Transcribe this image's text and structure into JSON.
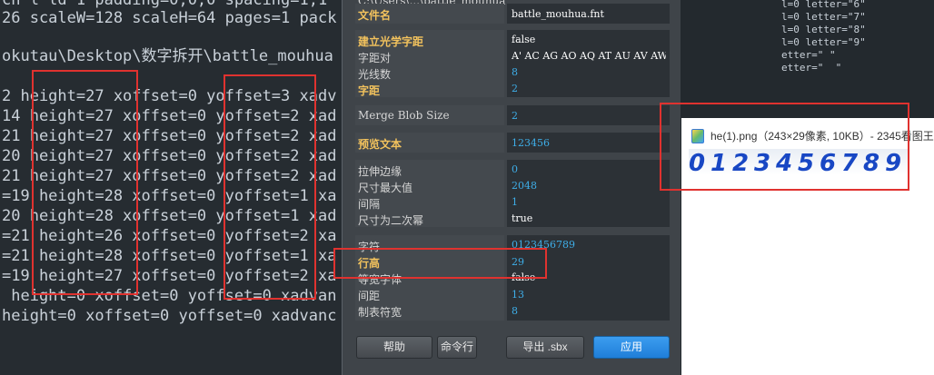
{
  "editor": {
    "lines": [
      "ch l ld 1 padding=0,0,0 spacing=1,1",
      "26 scaleW=128 scaleH=64 pages=1 pack",
      "",
      "okutau\\Desktop\\数字拆开\\battle_mouhua",
      "",
      "2 height=27 xoffset=0 yoffset=3 xadv",
      "14 height=27 xoffset=0 yoffset=2 xad",
      "21 height=27 xoffset=0 yoffset=2 xad",
      "20 height=27 xoffset=0 yoffset=2 xad",
      "21 height=27 xoffset=0 yoffset=2 xad",
      "=19 height=28 xoffset=0 yoffset=1 xa",
      "20 height=28 xoffset=0 yoffset=1 xad",
      "=21 height=26 xoffset=0 yoffset=2 xa",
      "=21 height=28 xoffset=0 yoffset=1 xa",
      "=19 height=27 xoffset=0 yoffset=2 xa",
      " height=0 xoffset=0 yoffset=0 xadvan",
      "height=0 xoffset=0 yoffset=0 xadvanc"
    ]
  },
  "right_editor": {
    "lines": [
      "l=0 letter=\"6\"",
      "l=0 letter=\"7\"",
      "l=0 letter=\"8\"",
      "l=0 letter=\"9\"",
      "etter=\" \"",
      "etter=\"  \""
    ]
  },
  "dialog": {
    "top_label": "C:\\Users\\...\\battle_mouhua",
    "file_name_label": "文件名",
    "file_name_value": "battle_mouhua.fnt",
    "build_label": "建立光学字距",
    "build_value": "false",
    "pair_label": "字距对",
    "pair_value": "A' AC AG AO AQ AT AU AV AW",
    "ray_label": "光线数",
    "ray_value": "8",
    "spacing_label": "字距",
    "spacing_value": "2",
    "merge_label": "Merge Blob Size",
    "merge_value": "2",
    "preview_label": "预览文本",
    "preview_value": "123456",
    "stretch_label": "拉伸边缘",
    "stretch_value": "0",
    "maxsize_label": "尺寸最大值",
    "maxsize_value": "2048",
    "gap_label": "间隔",
    "gap_value": "1",
    "pow2_label": "尺寸为二次幂",
    "pow2_value": "true",
    "chars_label": "字符",
    "chars_value": "0123456789",
    "lineheight_label": "行高",
    "lineheight_value": "29",
    "mono_label": "等宽字体",
    "mono_value": "false",
    "linespacing_label": "间距",
    "linespacing_value": "13",
    "tab_label": "制表符宽",
    "tab_value": "8",
    "help_button": "帮助",
    "cmd_button": "命令行",
    "export_button": "导出 .sbx",
    "apply_button": "应用"
  },
  "viewer": {
    "title": "he(1).png（243×29像素, 10KB）- 2345看图王",
    "digits": [
      "0",
      "1",
      "2",
      "3",
      "4",
      "5",
      "6",
      "7",
      "8",
      "9"
    ]
  },
  "colors": {
    "annotation_red": "#e0322f",
    "value_blue": "#3eaee8",
    "label_gold": "#f2c25d"
  }
}
